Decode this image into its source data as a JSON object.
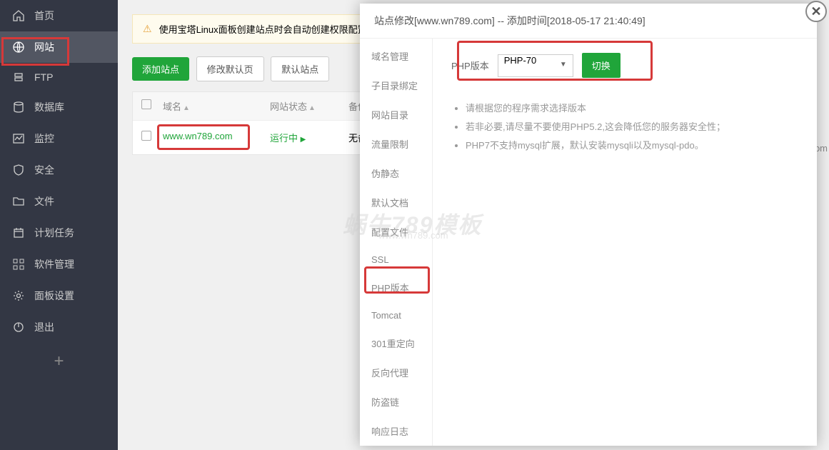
{
  "sidebar": {
    "items": [
      {
        "label": "首页",
        "icon": "home"
      },
      {
        "label": "网站",
        "icon": "globe"
      },
      {
        "label": "FTP",
        "icon": "ftp"
      },
      {
        "label": "数据库",
        "icon": "database"
      },
      {
        "label": "监控",
        "icon": "monitor"
      },
      {
        "label": "安全",
        "icon": "shield"
      },
      {
        "label": "文件",
        "icon": "folder"
      },
      {
        "label": "计划任务",
        "icon": "calendar"
      },
      {
        "label": "软件管理",
        "icon": "grid"
      },
      {
        "label": "面板设置",
        "icon": "gear"
      },
      {
        "label": "退出",
        "icon": "power"
      }
    ]
  },
  "alert": {
    "text": "使用宝塔Linux面板创建站点时会自动创建权限配置"
  },
  "toolbar": {
    "add_site": "添加站点",
    "modify_default": "修改默认页",
    "default_site": "默认站点"
  },
  "table": {
    "headers": {
      "domain": "域名",
      "status": "网站状态",
      "backup": "备份"
    },
    "rows": [
      {
        "domain": "www.wn789.com",
        "status": "运行中",
        "backup": "无备"
      }
    ]
  },
  "modal": {
    "title": "站点修改[www.wn789.com] -- 添加时间[2018-05-17 21:40:49]",
    "tabs": [
      "域名管理",
      "子目录绑定",
      "网站目录",
      "流量限制",
      "伪静态",
      "默认文档",
      "配置文件",
      "SSL",
      "PHP版本",
      "Tomcat",
      "301重定向",
      "反向代理",
      "防盗链",
      "响应日志"
    ],
    "php": {
      "label": "PHP版本",
      "selected": "PHP-70",
      "switch_btn": "切换"
    },
    "tips": [
      "请根据您的程序需求选择版本",
      "若非必要,请尽量不要使用PHP5.2,这会降低您的服务器安全性；",
      "PHP7不支持mysql扩展，默认安装mysqli以及mysql-pdo。"
    ]
  },
  "watermark": {
    "main": "蜗牛789模板",
    "sub": "www.wn789.com"
  },
  "cut_text": ".com"
}
